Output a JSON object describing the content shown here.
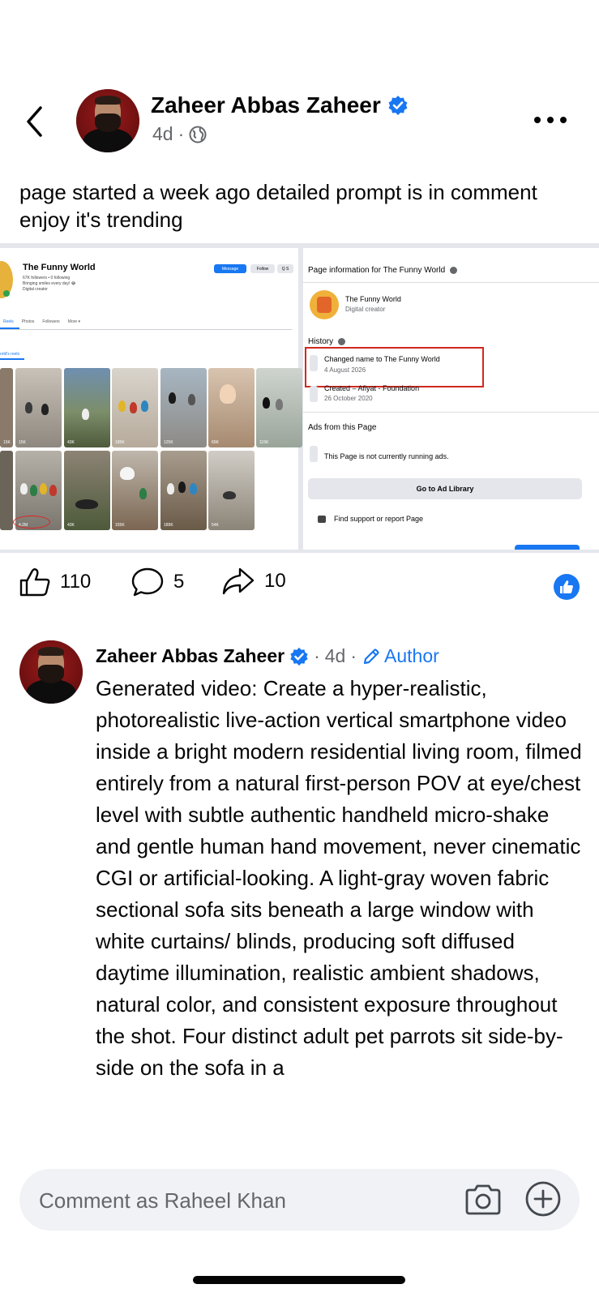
{
  "post": {
    "author": "Zaheer Abbas Zaheer",
    "time": "4d",
    "dot": "·",
    "caption": "page started a week ago detailed prompt is in comment enjoy it's trending"
  },
  "screenshot_left": {
    "page_name": "The Funny World",
    "stats": "67K followers • 0 following",
    "bio": "Bringing smiles every day! 😂",
    "category": "Digital creator",
    "buttons": [
      "Message",
      "Follow",
      "Q S"
    ],
    "tabs": [
      "Reels",
      "Photos",
      "Followers",
      "More ▾"
    ],
    "reels_label": "orld's reels",
    "reel_views": [
      "15K",
      "43K",
      "185K",
      "125K",
      "65K",
      "115K",
      "4.2M",
      "43K",
      "155K",
      "189K",
      "54K"
    ]
  },
  "screenshot_right": {
    "title": "Page information for The Funny World",
    "page_name": "The Funny World",
    "category": "Digital creator",
    "history_label": "History",
    "history": [
      {
        "title": "Changed name to The Funny World",
        "date": "4 August 2026"
      },
      {
        "title": "Created – Afiyat - Foundation",
        "date": "26 October 2020"
      }
    ],
    "ads_label": "Ads from this Page",
    "no_ads": "This Page is not currently running ads.",
    "ad_library": "Go to Ad Library",
    "report": "Find support or report Page"
  },
  "actions": {
    "likes": "110",
    "comments": "5",
    "shares": "10"
  },
  "comment": {
    "author": "Zaheer Abbas Zaheer",
    "time": "4d",
    "dot1": "·",
    "dot2": "·",
    "author_badge": "Author",
    "text": "Generated video: Create a hyper-realistic, photorealistic live-action vertical smartphone video inside a bright modern residential living room, filmed entirely from a natural first-person POV at eye/chest level with subtle authentic handheld micro-shake and gentle human hand movement, never cinematic CGI or artificial-looking. A light-gray woven fabric sectional sofa sits beneath a large window with white curtains/ blinds, producing soft diffused daytime illumination, realistic ambient shadows, natural color, and consistent exposure throughout the shot. Four distinct adult pet parrots sit side-by-side on the sofa in a"
  },
  "composer": {
    "placeholder": "Comment as Raheel Khan"
  },
  "colors": {
    "accent": "#1877f2",
    "text": "#050505",
    "muted": "#65676b",
    "highlight": "#d0291e"
  },
  "icons": [
    "back-chevron-icon",
    "verified-icon",
    "globe-icon",
    "more-icon",
    "like-icon",
    "comment-icon",
    "share-icon",
    "like-badge-icon",
    "pencil-icon",
    "camera-icon",
    "plus-icon"
  ]
}
